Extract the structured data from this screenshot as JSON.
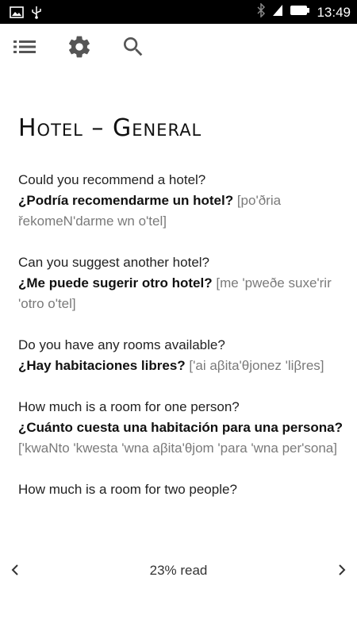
{
  "status_bar": {
    "time": "13:49",
    "left_icons": [
      "image-icon",
      "usb-icon"
    ],
    "right_icons": [
      "bluetooth-icon",
      "wifi-icon",
      "battery-icon"
    ]
  },
  "toolbar": {
    "icons": [
      "list-icon",
      "settings-gear-icon",
      "search-icon"
    ],
    "icon_color": "#555555"
  },
  "page": {
    "title": "Hotel – General",
    "entries": [
      {
        "english": "Could you recommend a hotel?",
        "spanish": "¿Podría recomendarme un hotel?",
        "pronunciation": "[po'ðria řekomeN'darme wn o'tel]"
      },
      {
        "english": "Can you suggest another hotel?",
        "spanish": "¿Me puede sugerir otro hotel?",
        "pronunciation": "[me 'pweðe suxe'rir 'otro o'tel]"
      },
      {
        "english": "Do you have any rooms available?",
        "spanish": "¿Hay habitaciones libres?",
        "pronunciation": "['ai aβita'θjonez 'liβres]"
      },
      {
        "english": "How much is a room for one person?",
        "spanish": "¿Cuánto cuesta una habitación para una persona?",
        "pronunciation": "['kwaNto 'kwesta 'wna aβita'θjom 'para 'wna per'sona]"
      },
      {
        "english": "How much is a room for two people?",
        "spanish": "",
        "pronunciation": ""
      }
    ]
  },
  "footer": {
    "progress_label": "23% read",
    "progress_percent": 23,
    "prev_icon": "chevron-left-icon",
    "next_icon": "chevron-right-icon"
  }
}
